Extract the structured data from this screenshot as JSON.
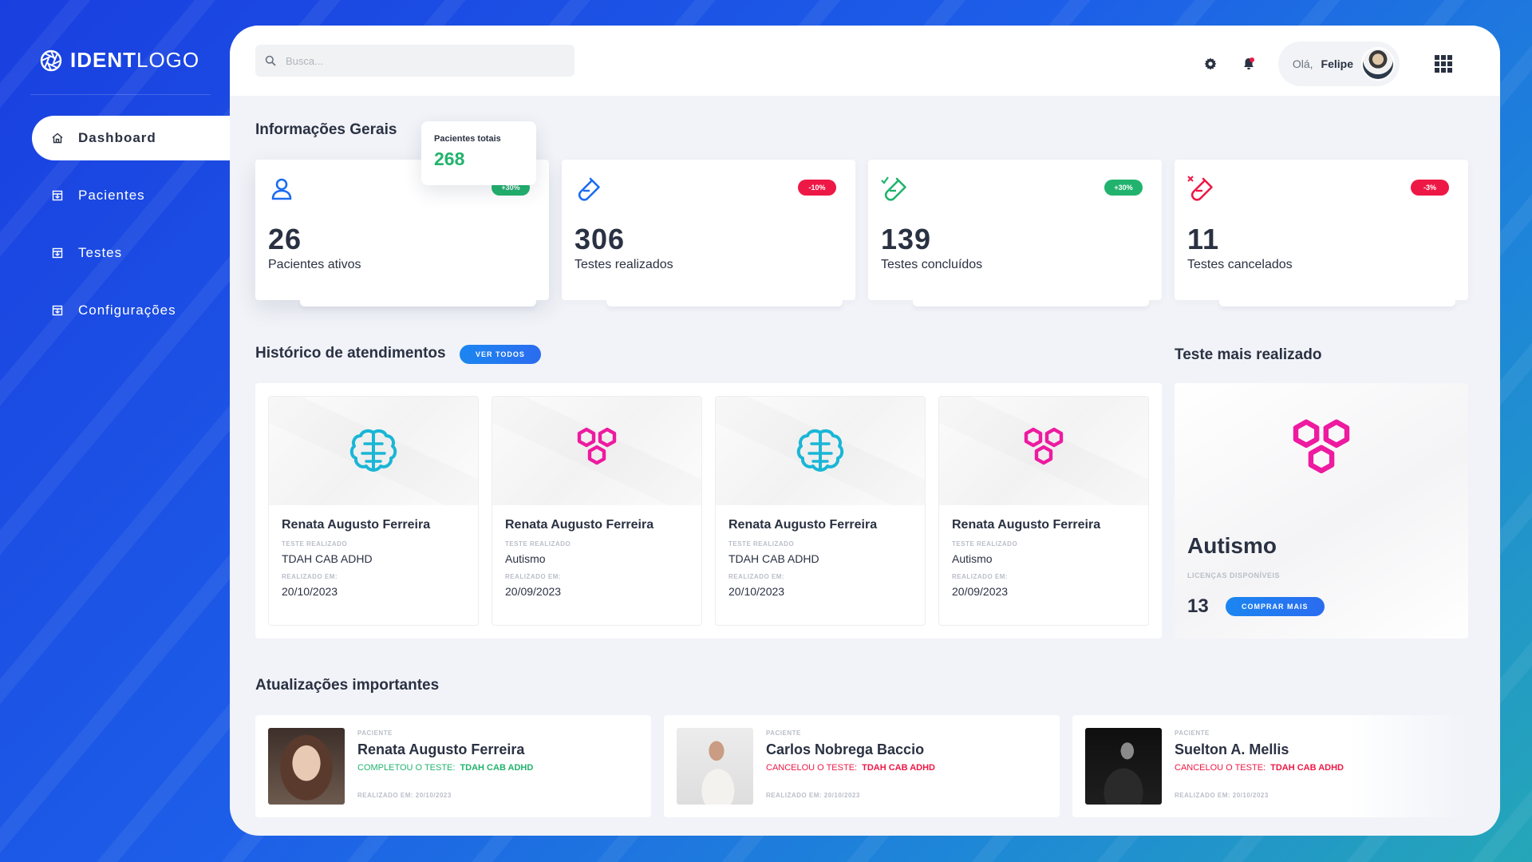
{
  "brand": {
    "bold": "IDENT",
    "light": "LOGO"
  },
  "nav": {
    "items": [
      {
        "label": "Dashboard",
        "icon": "home-icon"
      },
      {
        "label": "Pacientes",
        "icon": "inbox-icon"
      },
      {
        "label": "Testes",
        "icon": "inbox-icon"
      },
      {
        "label": "Configurações",
        "icon": "inbox-icon"
      }
    ],
    "active": "Dashboard"
  },
  "search": {
    "placeholder": "Busca..."
  },
  "user": {
    "greeting": "Olá,",
    "name": "Felipe"
  },
  "overview": {
    "title": "Informações Gerais",
    "tooltip": {
      "label": "Pacientes totais",
      "value": "268"
    },
    "stats": [
      {
        "value": "26",
        "label": "Pacientes ativos",
        "badge": "+30%",
        "trend": "up",
        "icon": "user-icon"
      },
      {
        "value": "306",
        "label": "Testes realizados",
        "badge": "-10%",
        "trend": "down",
        "icon": "test-tube-icon"
      },
      {
        "value": "139",
        "label": "Testes concluídos",
        "badge": "+30%",
        "trend": "up",
        "icon": "test-tube-check-icon"
      },
      {
        "value": "11",
        "label": "Testes cancelados",
        "badge": "-3%",
        "trend": "down",
        "icon": "test-tube-x-icon"
      }
    ]
  },
  "history": {
    "title": "Histórico de atendimentos",
    "see_all": "VER TODOS",
    "test_caption": "TESTE REALIZADO",
    "date_caption": "REALIZADO EM:",
    "items": [
      {
        "name": "Renata Augusto Ferreira",
        "test": "TDAH CAB ADHD",
        "date": "20/10/2023",
        "icon": "brain-icon"
      },
      {
        "name": "Renata Augusto Ferreira",
        "test": "Autismo",
        "date": "20/09/2023",
        "icon": "hexagons-icon"
      },
      {
        "name": "Renata Augusto Ferreira",
        "test": "TDAH CAB ADHD",
        "date": "20/10/2023",
        "icon": "brain-icon"
      },
      {
        "name": "Renata Augusto Ferreira",
        "test": "Autismo",
        "date": "20/09/2023",
        "icon": "hexagons-icon"
      }
    ]
  },
  "top_test": {
    "title": "Teste mais realizado",
    "name": "Autismo",
    "caption": "LICENÇAS DISPONÍVEIS",
    "count": "13",
    "button": "COMPRAR MAIS"
  },
  "updates": {
    "title": "Atualizações importantes",
    "items": [
      {
        "caption": "PACIENTE",
        "name": "Renata Augusto Ferreira",
        "action": "COMPLETOU O TESTE:",
        "test": "TDAH CAB ADHD",
        "status": "done",
        "date": "REALIZADO EM: 20/10/2023"
      },
      {
        "caption": "PACIENTE",
        "name": "Carlos Nobrega Baccio",
        "action": "CANCELOU O TESTE:",
        "test": "TDAH CAB ADHD",
        "status": "cancel",
        "date": "REALIZADO EM: 20/10/2023"
      },
      {
        "caption": "PACIENTE",
        "name": "Suelton A. Mellis",
        "action": "CANCELOU O TESTE:",
        "test": "TDAH CAB ADHD",
        "status": "cancel",
        "date": "REALIZADO EM: 20/10/2023"
      }
    ]
  },
  "colors": {
    "accent": "#1b86f0",
    "positive": "#21b36d",
    "negative": "#ee1846",
    "brain": "#19b6d6",
    "hexagon": "#ee1aa0"
  }
}
